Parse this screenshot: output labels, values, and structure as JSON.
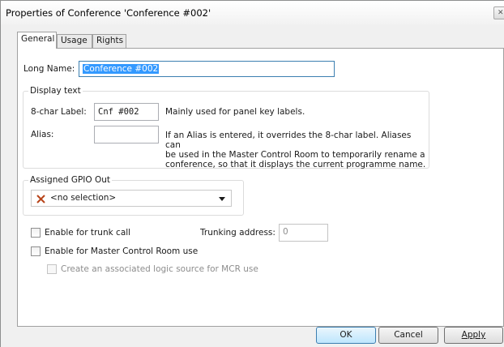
{
  "window": {
    "title": "Properties of Conference 'Conference #002'"
  },
  "tabs": [
    {
      "label": "General"
    },
    {
      "label": "Usage"
    },
    {
      "label": "Rights"
    }
  ],
  "general": {
    "long_name_label": "Long Name:",
    "long_name_value": "Conference #002",
    "display_text": {
      "legend": "Display text",
      "label8_label": "8-char Label:",
      "label8_value": "Cnf #002",
      "label8_hint": "Mainly used for panel key labels.",
      "alias_label": "Alias:",
      "alias_value": "",
      "alias_hint_lines": [
        "If an Alias is entered, it overrides the 8-char label. Aliases can",
        "be used in the Master Control Room to temporarily rename a",
        "conference, so that it displays the current programme name."
      ]
    },
    "gpio": {
      "legend": "Assigned GPIO Out",
      "selected": "<no selection>"
    },
    "trunk_call": {
      "label": "Enable for trunk call",
      "checked": false
    },
    "trunking_address": {
      "label": "Trunking address:",
      "value": "0"
    },
    "mcr_use": {
      "label": "Enable for Master Control Room use",
      "checked": false
    },
    "logic_source": {
      "label": "Create an associated logic source for MCR use",
      "checked": false
    }
  },
  "buttons": {
    "ok": "OK",
    "cancel": "Cancel",
    "apply": "Apply"
  },
  "colors": {
    "selection": "#3399ff",
    "x_icon": "#b8451b",
    "default_button_border": "#3c7fb1"
  }
}
